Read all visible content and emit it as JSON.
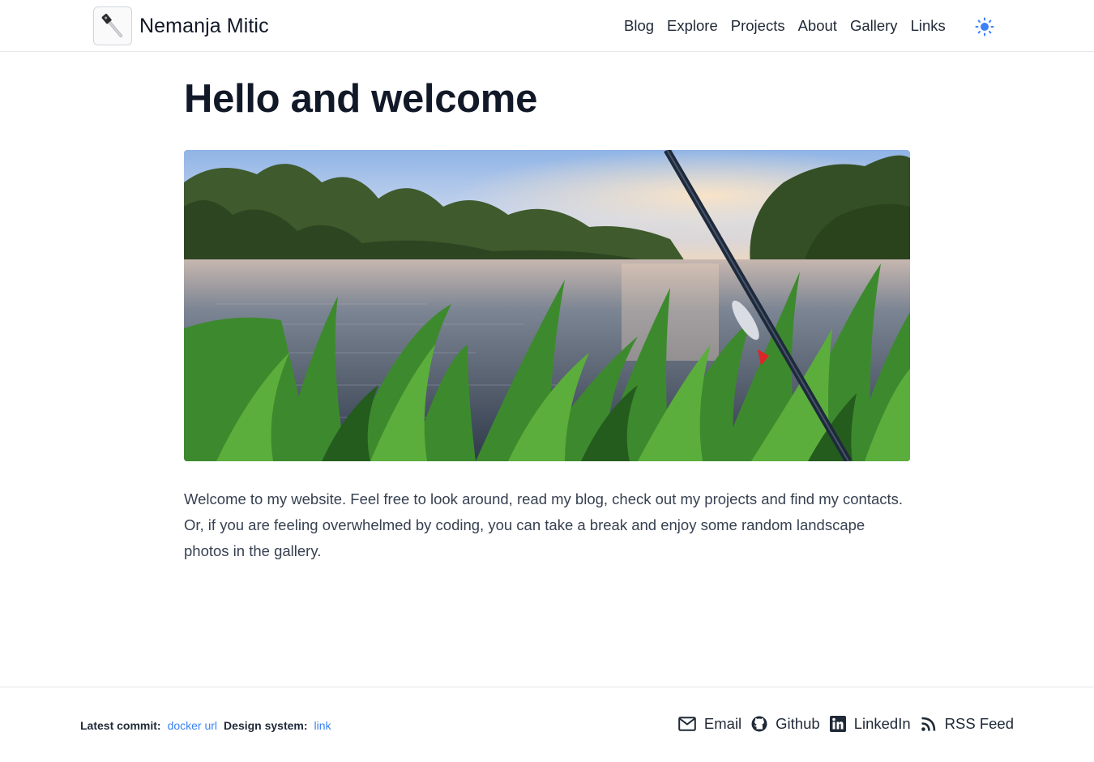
{
  "header": {
    "site_name": "Nemanja Mitic",
    "nav": [
      {
        "label": "Blog"
      },
      {
        "label": "Explore"
      },
      {
        "label": "Projects"
      },
      {
        "label": "About"
      },
      {
        "label": "Gallery"
      },
      {
        "label": "Links"
      }
    ],
    "theme_icon": "sun-icon"
  },
  "main": {
    "title": "Hello and welcome",
    "intro": "Welcome to my website. Feel free to look around, read my blog, check out my projects and find my contacts. Or, if you are feeling overwhelmed by coding, you can take a break and enjoy some random landscape photos in the gallery."
  },
  "footer": {
    "commit_label": "Latest commit:",
    "commit_link": "docker url",
    "design_label": "Design system:",
    "design_link": "link",
    "links": [
      {
        "label": "Email",
        "icon": "mail-icon"
      },
      {
        "label": "Github",
        "icon": "github-icon"
      },
      {
        "label": "LinkedIn",
        "icon": "linkedin-icon"
      },
      {
        "label": "RSS Feed",
        "icon": "rss-icon"
      }
    ]
  },
  "colors": {
    "accent": "#3b82f6",
    "text": "#1f2937",
    "heading": "#111827",
    "border": "#e5e7eb"
  }
}
